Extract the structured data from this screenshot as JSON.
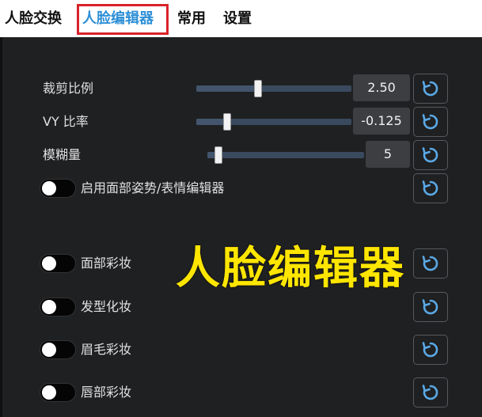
{
  "tabs": [
    {
      "label": "人脸交换",
      "active": false
    },
    {
      "label": "人脸编辑器",
      "active": true
    },
    {
      "label": "常用",
      "active": false
    },
    {
      "label": "设置",
      "active": false
    }
  ],
  "sliders": [
    {
      "label": "裁剪比例",
      "value": "2.50",
      "fraction": 0.4
    },
    {
      "label": "VY 比率",
      "value": "-0.125",
      "fraction": 0.2
    },
    {
      "label": "模糊量",
      "value": "5",
      "fraction": 0.07
    }
  ],
  "toggles": [
    {
      "label": "启用面部姿势/表情编辑器",
      "on": false
    },
    {
      "label": "面部彩妆",
      "on": false
    },
    {
      "label": "发型化妆",
      "on": false
    },
    {
      "label": "眉毛彩妆",
      "on": false
    },
    {
      "label": "唇部彩妆",
      "on": false
    }
  ],
  "overlay_title": "人脸编辑器",
  "colors": {
    "accent": "#2d8fd6",
    "highlight": "#d9232a",
    "overlay": "#ffe600",
    "reset_icon": "#5aa9e6"
  },
  "icons": {
    "reset": "reset-icon"
  }
}
